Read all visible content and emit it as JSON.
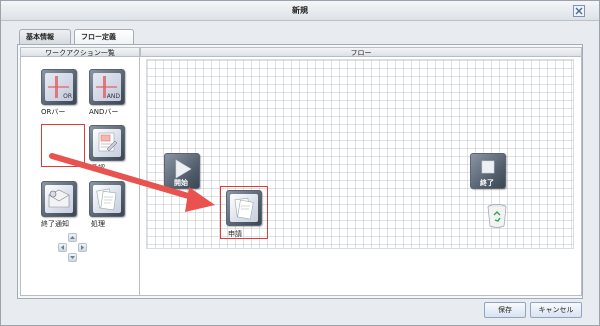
{
  "window": {
    "title": "新規"
  },
  "tabs": [
    {
      "label": "基本情報"
    },
    {
      "label": "フロー定義"
    }
  ],
  "palette": {
    "header": "ワークアクション一覧",
    "items": [
      {
        "label": "ORバー",
        "icon": "or-bar-icon",
        "badge": "OR"
      },
      {
        "label": "ANDバー",
        "icon": "and-bar-icon",
        "badge": "AND"
      },
      {
        "label": "",
        "icon": "empty-slot"
      },
      {
        "label": "承認",
        "icon": "approval-icon"
      },
      {
        "label": "終了通知",
        "icon": "end-notification-icon"
      },
      {
        "label": "処理",
        "icon": "process-icon"
      }
    ]
  },
  "flow": {
    "header": "フロー",
    "nodes": [
      {
        "label": "開始",
        "icon": "play-icon"
      },
      {
        "label": "終了",
        "icon": "stop-icon"
      },
      {
        "label": "申請",
        "icon": "application-icon"
      }
    ],
    "trash_icon": "recycle-bin-icon"
  },
  "buttons": {
    "save": "保存",
    "cancel": "キャンセル"
  },
  "colors": {
    "accent_red": "#e8534f",
    "selection_red": "#e03b3b"
  }
}
